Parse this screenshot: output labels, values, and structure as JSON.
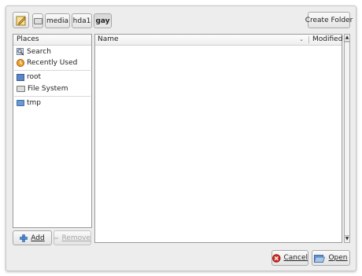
{
  "toolbar": {
    "path_buttons": [
      "media",
      "hda1",
      "gay"
    ],
    "create_folder_label": "Create Folder"
  },
  "places": {
    "header": "Places",
    "items": [
      {
        "label": "Search",
        "icon": "search-icon"
      },
      {
        "label": "Recently Used",
        "icon": "recent-icon"
      },
      {
        "label": "root",
        "icon": "home-folder-icon"
      },
      {
        "label": "File System",
        "icon": "drive-icon"
      },
      {
        "label": "tmp",
        "icon": "folder-icon"
      }
    ],
    "add_label": "Add",
    "remove_label": "Remove"
  },
  "files": {
    "col_name": "Name",
    "col_modified": "Modified"
  },
  "actions": {
    "cancel_label": "Cancel",
    "open_label": "Open"
  }
}
